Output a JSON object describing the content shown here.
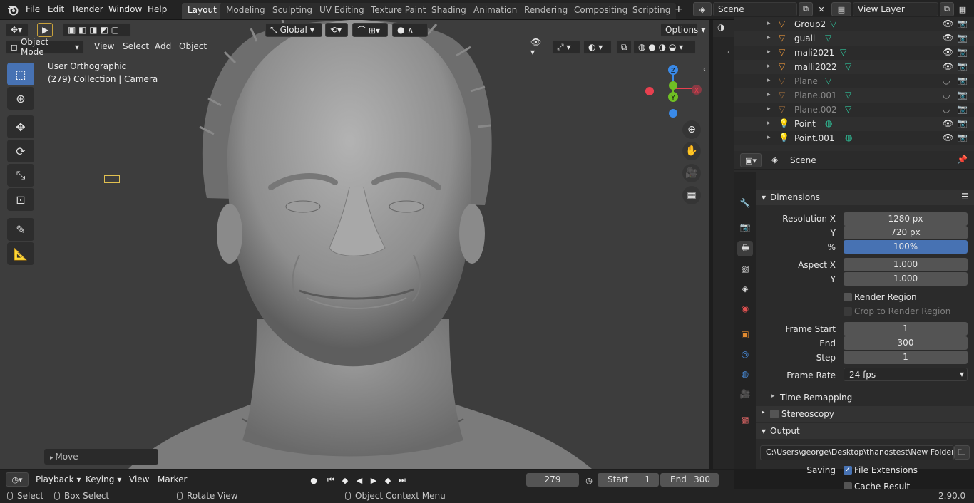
{
  "topbar": {
    "menus": [
      "File",
      "Edit",
      "Render",
      "Window",
      "Help"
    ],
    "workspaces": [
      "Layout",
      "Modeling",
      "Sculpting",
      "UV Editing",
      "Texture Paint",
      "Shading",
      "Animation",
      "Rendering",
      "Compositing",
      "Scripting"
    ],
    "active_workspace": "Layout",
    "add_tab_label": "+",
    "scene_name": "Scene",
    "view_layer_name": "View Layer"
  },
  "viewport": {
    "transform_orientation": "Global",
    "options_label": "Options",
    "mode": "Object Mode",
    "menus": [
      "View",
      "Select",
      "Add",
      "Object"
    ],
    "overlay_view_name": "User Orthographic",
    "overlay_collection_info": "(279) Collection | Camera",
    "operator_panel_label": "Move",
    "gizmo": {
      "x": "X",
      "y": "Y",
      "z": "Z"
    }
  },
  "outliner": {
    "rows": [
      {
        "name": "Group2",
        "dim": false
      },
      {
        "name": "guali",
        "dim": false
      },
      {
        "name": "mali2021",
        "dim": false
      },
      {
        "name": "malli2022",
        "dim": false
      },
      {
        "name": "Plane",
        "dim": true
      },
      {
        "name": "Plane.001",
        "dim": true
      },
      {
        "name": "Plane.002",
        "dim": true
      },
      {
        "name": "Point",
        "dim": false
      },
      {
        "name": "Point.001",
        "dim": false
      }
    ]
  },
  "properties": {
    "context": "Scene",
    "dimensions": {
      "header": "Dimensions",
      "res_x_label": "Resolution X",
      "res_x": "1280 px",
      "res_y_label": "Y",
      "res_y": "720 px",
      "pct_label": "%",
      "pct": "100%",
      "aspect_x_label": "Aspect X",
      "aspect_x": "1.000",
      "aspect_y_label": "Y",
      "aspect_y": "1.000",
      "render_region": "Render Region",
      "crop_region": "Crop to Render Region",
      "frame_start_label": "Frame Start",
      "frame_start": "1",
      "end_label": "End",
      "end": "300",
      "step_label": "Step",
      "step": "1",
      "frame_rate_label": "Frame Rate",
      "frame_rate": "24 fps",
      "time_remapping": "Time Remapping"
    },
    "stereoscopy": "Stereoscopy",
    "output": {
      "header": "Output",
      "path": "C:\\Users\\george\\Desktop\\thanostest\\New Folder\\",
      "saving_label": "Saving",
      "file_extensions": "File Extensions",
      "cache_result": "Cache Result"
    }
  },
  "timeline": {
    "menus": [
      "Playback",
      "Keying",
      "View",
      "Marker"
    ],
    "current_frame": "279",
    "start_label": "Start",
    "start": "1",
    "end_label": "End",
    "end": "300"
  },
  "status": {
    "select": "Select",
    "box_select": "Box Select",
    "rotate_view": "Rotate View",
    "context_menu": "Object Context Menu",
    "version": "2.90.0"
  },
  "colors": {
    "accent": "#4772b3",
    "background": "#3d3d3d",
    "header": "#232323",
    "gizmo_x": "#e8404f",
    "gizmo_y": "#6fbf24",
    "gizmo_z": "#3a8ae8"
  }
}
